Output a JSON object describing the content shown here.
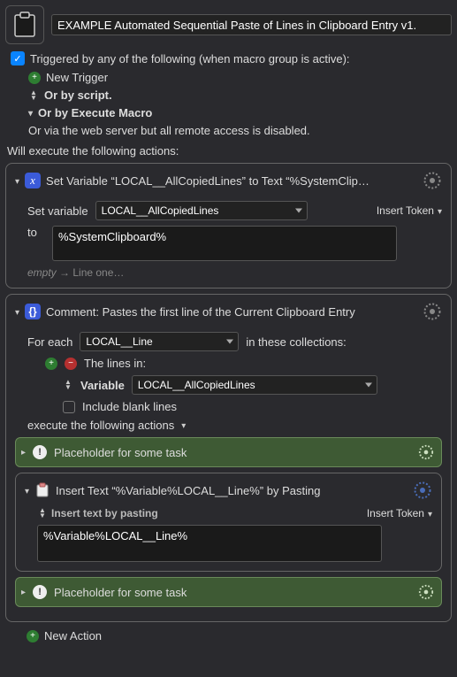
{
  "header": {
    "title_value": "EXAMPLE Automated Sequential Paste of Lines in Clipboard Entry v1."
  },
  "triggers": {
    "heading": "Triggered by any of the following (when macro group is active):",
    "new_trigger": "New Trigger",
    "or_script": "Or by script.",
    "or_execute": "Or by Execute Macro",
    "or_webserver": "Or via the web server but all remote access is disabled."
  },
  "exec_label": "Will execute the following actions:",
  "action1": {
    "title": "Set Variable “LOCAL__AllCopiedLines” to Text “%SystemClip…",
    "label_set": "Set variable",
    "var_value": "LOCAL__AllCopiedLines",
    "insert_token": "Insert Token",
    "to_label": "to",
    "text_value": "%SystemClipboard%",
    "hint_empty": "empty",
    "hint_arrow": " → ",
    "hint_val": "Line one…"
  },
  "action2": {
    "title": "Comment: Pastes the first line of the Current Clipboard Entry",
    "foreach_label": "For each",
    "foreach_var": "LOCAL__Line",
    "collections_label": "in these collections:",
    "lines_in": "The lines in:",
    "variable_label": "Variable",
    "variable_value": "LOCAL__AllCopiedLines",
    "include_blank": "Include blank lines",
    "exec_sub": "execute the following actions",
    "placeholder1": "Placeholder for some task",
    "insert_action": {
      "title": "Insert Text “%Variable%LOCAL__Line%” by Pasting",
      "mode": "Insert text by pasting",
      "insert_token": "Insert Token",
      "text_value": "%Variable%LOCAL__Line%"
    },
    "placeholder2": "Placeholder for some task"
  },
  "footer": {
    "new_action": "New Action"
  }
}
